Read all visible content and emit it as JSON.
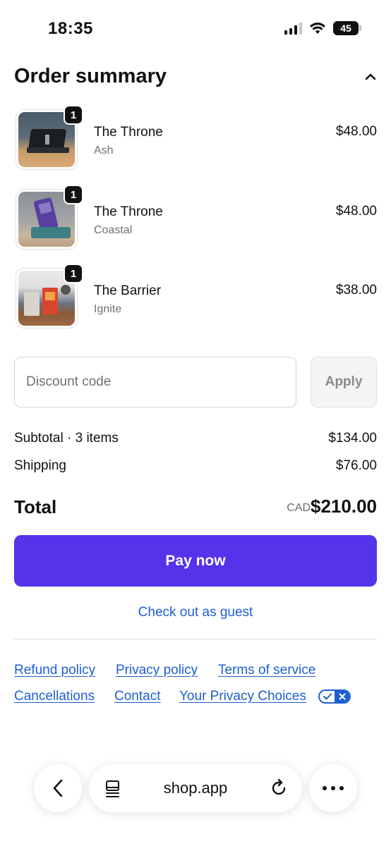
{
  "status_bar": {
    "time": "18:35",
    "battery": "45",
    "icons": [
      "signal-icon",
      "wifi-icon",
      "battery-icon"
    ]
  },
  "summary": {
    "title": "Order summary",
    "toggle_icon": "chevron-up-icon"
  },
  "items": [
    {
      "quantity": "1",
      "name": "The Throne",
      "variant": "Ash",
      "price": "$48.00"
    },
    {
      "quantity": "1",
      "name": "The Throne",
      "variant": "Coastal",
      "price": "$48.00"
    },
    {
      "quantity": "1",
      "name": "The Barrier",
      "variant": "Ignite",
      "price": "$38.00"
    }
  ],
  "discount": {
    "placeholder": "Discount code",
    "value": "",
    "apply_label": "Apply"
  },
  "totals": {
    "subtotal_label": "Subtotal · 3 items",
    "subtotal_value": "$134.00",
    "shipping_label": "Shipping",
    "shipping_value": "$76.00",
    "total_label": "Total",
    "currency": "CAD",
    "total_value": "$210.00"
  },
  "actions": {
    "pay_label": "Pay now",
    "guest_label": "Check out as guest"
  },
  "policies": {
    "refund": "Refund policy",
    "privacy": "Privacy policy",
    "terms": "Terms of service",
    "cancellations": "Cancellations",
    "contact": "Contact",
    "privacy_choices": "Your Privacy Choices"
  },
  "browser": {
    "url": "shop.app",
    "icons": [
      "back-icon",
      "tabs-icon",
      "reload-icon",
      "more-icon"
    ]
  },
  "colors": {
    "accent": "#5433eb",
    "link": "#1f5fd1"
  }
}
